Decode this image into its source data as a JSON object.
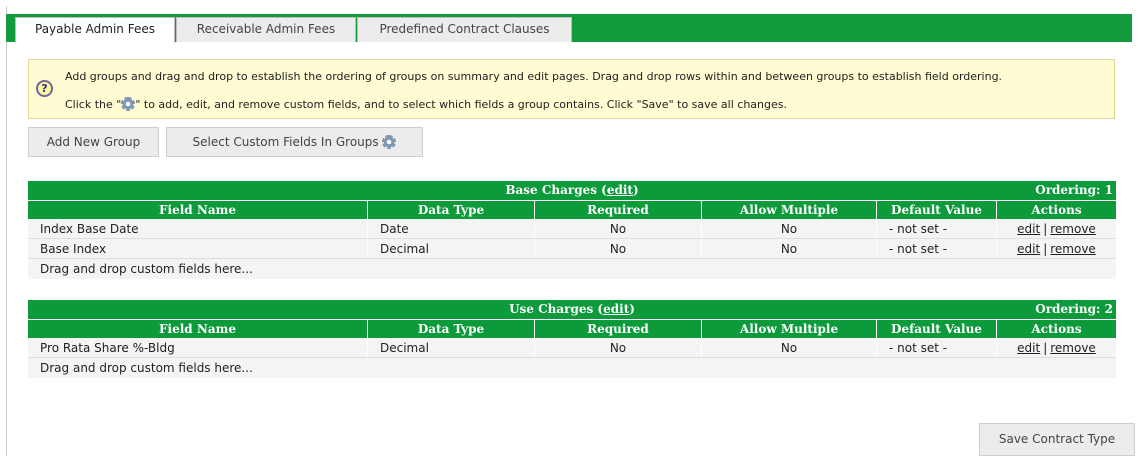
{
  "tabs": [
    "Payable Admin Fees",
    "Receivable Admin Fees",
    "Predefined Contract Clauses"
  ],
  "info": {
    "line1": "Add groups and drag and drop to establish the ordering of groups on summary and edit pages. Drag and drop rows within and between groups to establish field ordering.",
    "line2_prefix": "Click the \"",
    "line2_suffix": "\" to add, edit, and remove custom fields, and to select which fields a group contains. Click \"Save\" to save all changes."
  },
  "buttons": {
    "add_group": "Add New Group",
    "select_custom": "Select Custom Fields In Groups",
    "save": "Save Contract Type"
  },
  "columns": [
    "Field Name",
    "Data Type",
    "Required",
    "Allow Multiple",
    "Default Value",
    "Actions"
  ],
  "groups": [
    {
      "title": "Base Charges",
      "edit_link": "edit",
      "ordering": "Ordering: 1",
      "rows": [
        {
          "field": "Index Base Date",
          "type": "Date",
          "required": "No",
          "multiple": "No",
          "default": "- not set -",
          "edit": "edit",
          "sep": "|",
          "remove": "remove"
        },
        {
          "field": "Base Index",
          "type": "Decimal",
          "required": "No",
          "multiple": "No",
          "default": "- not set -",
          "edit": "edit",
          "sep": "|",
          "remove": "remove"
        }
      ],
      "drag_text": "Drag and drop custom fields here..."
    },
    {
      "title": "Use Charges",
      "edit_link": "edit",
      "ordering": "Ordering: 2",
      "rows": [
        {
          "field": "Pro Rata Share %-Bldg",
          "type": "Decimal",
          "required": "No",
          "multiple": "No",
          "default": "- not set -",
          "edit": "edit",
          "sep": "|",
          "remove": "remove"
        }
      ],
      "drag_text": "Drag and drop custom fields here..."
    }
  ],
  "colors": {
    "brand_green": "#129b3d",
    "info_bg": "#fffbd2"
  },
  "icons": {
    "help": "question-help-icon",
    "gear": "gear-icon"
  }
}
